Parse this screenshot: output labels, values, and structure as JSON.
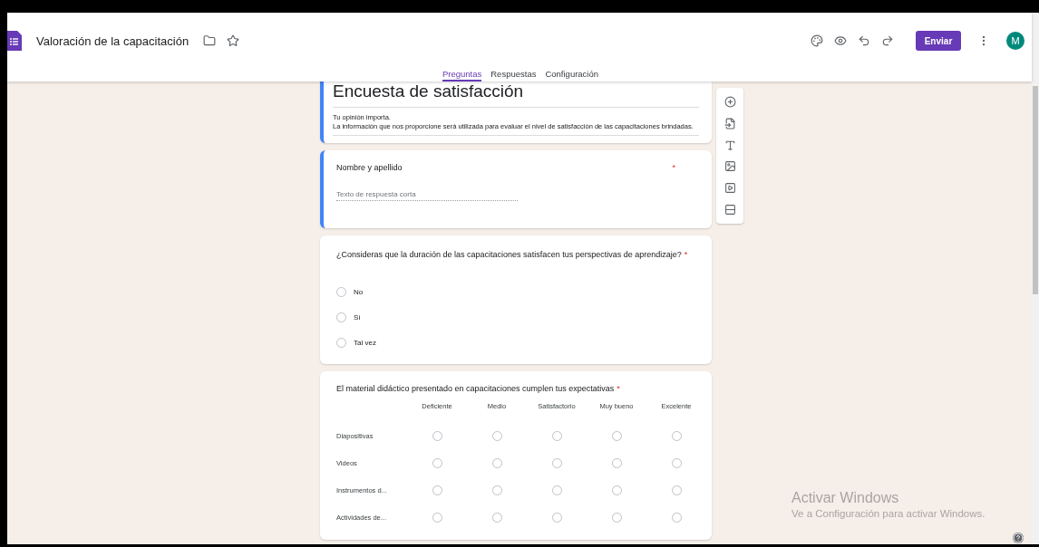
{
  "header": {
    "title": "Valoración de la capacitación",
    "send_button": "Enviar",
    "avatar": "M"
  },
  "tabs": [
    {
      "label": "Preguntas",
      "selected": true
    },
    {
      "label": "Respuestas",
      "selected": false
    },
    {
      "label": "Configuración",
      "selected": false
    }
  ],
  "form": {
    "title": "Encuesta de satisfacción",
    "description": [
      "Tu opinión importa.",
      "La información que nos proporcione será utilizada para evaluar el nivel de satisfacción de las capacitaciones brindadas."
    ],
    "selected": true
  },
  "questions": [
    {
      "kind": "short",
      "title": "Nombre y apellido",
      "required_mark": "*",
      "placeholder": "Texto de respuesta corta",
      "selected": true
    },
    {
      "kind": "choice",
      "title": "¿Consideras que la duración de las capacitaciones satisfacen tus perspectivas de aprendizaje?",
      "required_mark": "*",
      "selected": false,
      "options": [
        {
          "label": "No",
          "selected": false
        },
        {
          "label": "Sí",
          "selected": false
        },
        {
          "label": "Tal vez",
          "selected": false
        }
      ]
    },
    {
      "kind": "grid",
      "title": "El material didáctico presentado en capacitaciones cumplen tus expectativas",
      "required_mark": "*",
      "selected": false,
      "columns": [
        "Deficiente",
        "Medio",
        "Satisfactorio",
        "Muy bueno",
        "Excelente"
      ],
      "rows": [
        "Diapositivas",
        "Videos",
        "Instrumentos d...",
        "Actividades de..."
      ]
    }
  ],
  "watermark": {
    "title": "Activar Windows",
    "text": "Ve a Configuración para activar Windows."
  }
}
